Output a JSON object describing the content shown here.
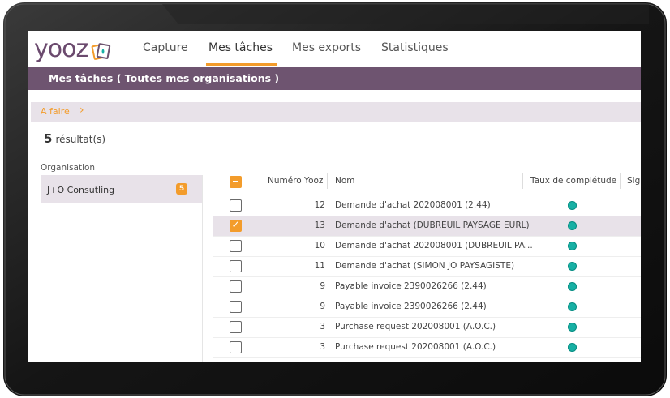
{
  "app": {
    "logo_text": "yooz",
    "nav_tabs": [
      {
        "label": "Capture",
        "active": false
      },
      {
        "label": "Mes tâches",
        "active": true
      },
      {
        "label": "Mes exports",
        "active": false
      },
      {
        "label": "Statistiques",
        "active": false
      }
    ]
  },
  "title_bar": "Mes tâches ( Toutes mes organisations )",
  "breadcrumb": {
    "label": "A faire",
    "chevron": "chevron-right-icon"
  },
  "results": {
    "count": "5",
    "label": "résultat(s)"
  },
  "organisation": {
    "heading": "Organisation",
    "items": [
      {
        "label": "J+O Consutling",
        "badge": "5"
      }
    ]
  },
  "table": {
    "columns": [
      "Numéro Yooz",
      "Nom",
      "Taux de complétude",
      "Sig"
    ],
    "rows": [
      {
        "numero": "12",
        "nom": "Demande d'achat 202008001 (2.44)",
        "checked": false
      },
      {
        "numero": "13",
        "nom": "Demande d'achat (DUBREUIL PAYSAGE EURL)",
        "checked": true
      },
      {
        "numero": "10",
        "nom": "Demande d'achat 202008001 (DUBREUIL PA...",
        "checked": false
      },
      {
        "numero": "11",
        "nom": "Demande d'achat (SIMON JO PAYSAGISTE)",
        "checked": false
      },
      {
        "numero": "9",
        "nom": "Payable invoice 2390026266 (2.44)",
        "checked": false
      },
      {
        "numero": "9",
        "nom": "Payable invoice 2390026266 (2.44)",
        "checked": false
      },
      {
        "numero": "3",
        "nom": "Purchase request 202008001 (A.O.C.)",
        "checked": false
      },
      {
        "numero": "3",
        "nom": "Purchase request 202008001 (A.O.C.)",
        "checked": false
      }
    ]
  },
  "colors": {
    "accent": "#f39c2b",
    "brand": "#6e5470",
    "status": "#17b0a4"
  }
}
